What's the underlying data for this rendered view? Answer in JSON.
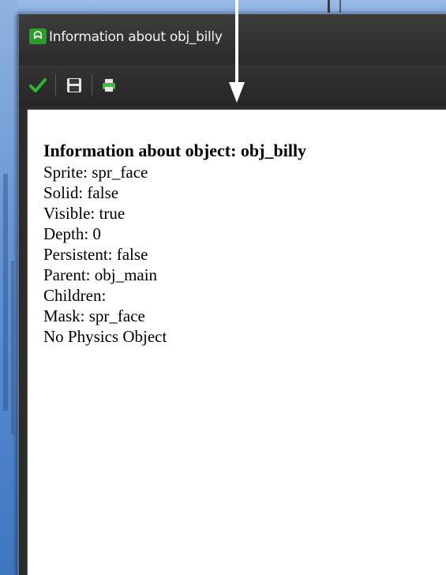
{
  "window": {
    "title": "Information about obj_billy",
    "app_icon": "gamemaker-icon"
  },
  "toolbar": {
    "items": [
      {
        "name": "ok",
        "icon": "checkmark-icon",
        "color": "#2fb52f"
      },
      {
        "name": "save",
        "icon": "save-icon"
      },
      {
        "name": "print",
        "icon": "print-icon",
        "color": "#3dbf3d"
      }
    ]
  },
  "info": {
    "heading": "Information about object: obj_billy",
    "lines": [
      "Sprite: spr_face",
      "Solid: false",
      "Visible: true",
      "Depth: 0",
      "Persistent: false",
      "Parent: obj_main",
      "Children:",
      "Mask: spr_face",
      "No Physics Object"
    ]
  },
  "colors": {
    "titlebar": "#2e2e2e",
    "content_bg": "#ffffff",
    "annotation_arrow": "#ffffff"
  }
}
